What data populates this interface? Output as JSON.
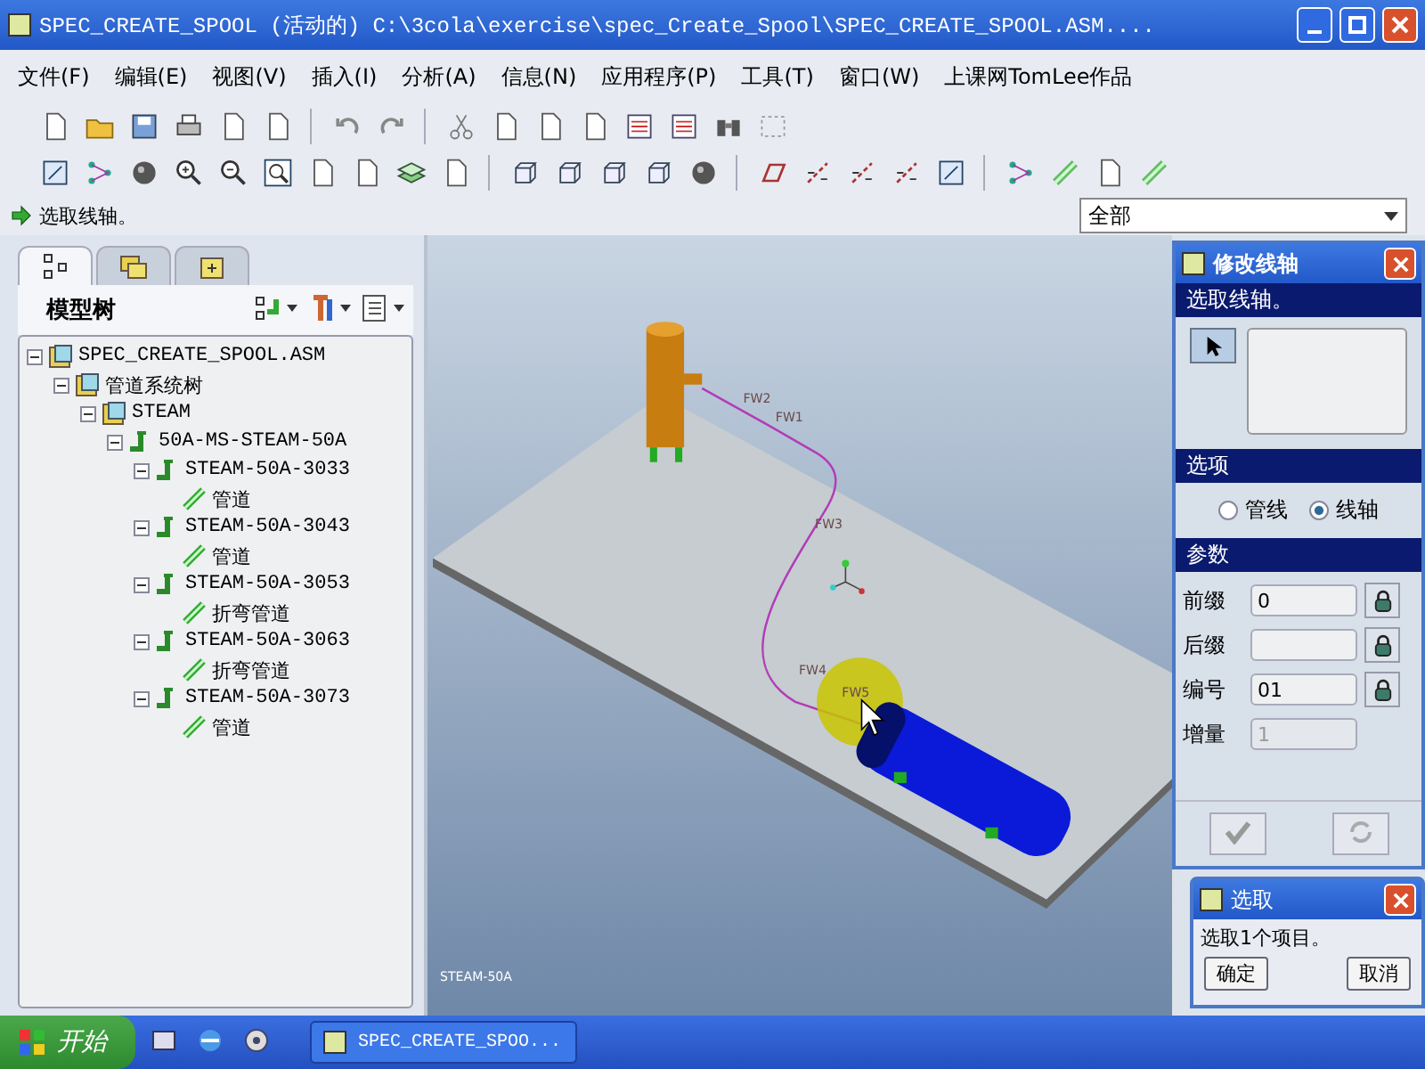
{
  "window": {
    "title": "SPEC_CREATE_SPOOL (活动的) C:\\3cola\\exercise\\spec_Create_Spool\\SPEC_CREATE_SPOOL.ASM...."
  },
  "menu": [
    "文件(F)",
    "编辑(E)",
    "视图(V)",
    "插入(I)",
    "分析(A)",
    "信息(N)",
    "应用程序(P)",
    "工具(T)",
    "窗口(W)",
    "上课网TomLee作品"
  ],
  "status": {
    "message": "选取线轴。",
    "filter": "全部"
  },
  "model_tree": {
    "title": "模型树",
    "tabs": [
      {
        "kind": "tree",
        "selected": true
      },
      {
        "kind": "layers",
        "selected": false
      },
      {
        "kind": "favorites",
        "selected": false
      }
    ],
    "items": [
      {
        "label": "SPEC_CREATE_SPOOL.ASM",
        "kind": "assembly",
        "expanded": true,
        "children": [
          {
            "label": "管道系统树",
            "kind": "assembly",
            "expanded": true,
            "children": [
              {
                "label": "STEAM",
                "kind": "assembly",
                "expanded": true,
                "children": [
                  {
                    "label": "50A-MS-STEAM-50A",
                    "kind": "spool",
                    "expanded": true,
                    "children": [
                      {
                        "label": "STEAM-50A-3033",
                        "kind": "spool",
                        "expanded": true,
                        "children": [
                          {
                            "label": "管道",
                            "kind": "pipe"
                          }
                        ]
                      },
                      {
                        "label": "STEAM-50A-3043",
                        "kind": "spool",
                        "expanded": true,
                        "children": [
                          {
                            "label": "管道",
                            "kind": "pipe"
                          }
                        ]
                      },
                      {
                        "label": "STEAM-50A-3053",
                        "kind": "spool",
                        "expanded": true,
                        "children": [
                          {
                            "label": "折弯管道",
                            "kind": "pipe"
                          }
                        ]
                      },
                      {
                        "label": "STEAM-50A-3063",
                        "kind": "spool",
                        "expanded": true,
                        "children": [
                          {
                            "label": "折弯管道",
                            "kind": "pipe"
                          }
                        ]
                      },
                      {
                        "label": "STEAM-50A-3073",
                        "kind": "spool",
                        "expanded": true,
                        "children": [
                          {
                            "label": "管道",
                            "kind": "pipe"
                          }
                        ]
                      }
                    ]
                  }
                ]
              }
            ]
          }
        ]
      }
    ]
  },
  "viewport": {
    "labels": [
      "FW2",
      "FW1",
      "FW3",
      "FW4",
      "FW5"
    ],
    "caption": "STEAM-50A"
  },
  "dialog": {
    "title": "修改线轴",
    "prompt": "选取线轴。",
    "options_title": "选项",
    "options": [
      {
        "label": "管线",
        "selected": false
      },
      {
        "label": "线轴",
        "selected": true
      }
    ],
    "params_title": "参数",
    "fields": [
      {
        "label": "前缀",
        "value": "0",
        "disabled": false,
        "lock": true
      },
      {
        "label": "后缀",
        "disabled": false,
        "lock": true
      },
      {
        "label": "编号",
        "value": "01",
        "disabled": false,
        "lock": true
      },
      {
        "label": "增量",
        "value": "1",
        "disabled": true,
        "lock": false
      }
    ]
  },
  "select_dialog": {
    "title": "选取",
    "message": "选取1个项目。",
    "buttons": [
      "确定",
      "取消"
    ]
  },
  "taskbar": {
    "start": "开始",
    "task": "SPEC_CREATE_SPOO..."
  }
}
